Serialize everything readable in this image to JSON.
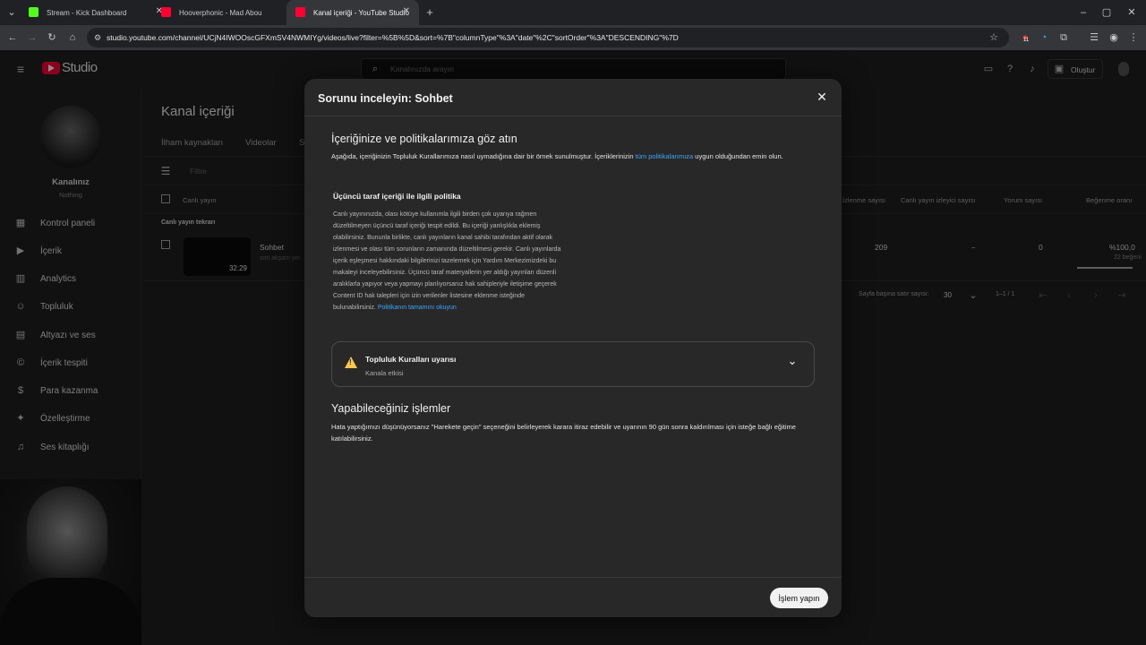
{
  "browser": {
    "tabs": [
      {
        "title": "Stream - Kick Dashboard",
        "color": "#53fc18"
      },
      {
        "title": "Hooverphonic - Mad Abou",
        "color": "#ff0033"
      },
      {
        "title": "Kanal içeriği - YouTube Studio",
        "color": "#ff0033"
      }
    ],
    "url": "studio.youtube.com/channel/UCjN4IWOOscGFXmSV4NWMIYg/videos/live?filter=%5B%5D&sort=%7B\"columnType\"%3A\"date\"%2C\"sortOrder\"%3A\"DESCENDING\"%7D",
    "ext_badge": "11"
  },
  "studio": {
    "logo": "Studio",
    "search_placeholder": "Kanalınızda arayın",
    "create_label": "Oluştur",
    "channel_name": "Kanalınız",
    "channel_sub": "Nothing",
    "nav": [
      {
        "label": "Kontrol paneli",
        "icon": "dashboard-icon",
        "glyph": "▦"
      },
      {
        "label": "İçerik",
        "icon": "content-icon",
        "glyph": "▶"
      },
      {
        "label": "Analytics",
        "icon": "analytics-icon",
        "glyph": "▥"
      },
      {
        "label": "Topluluk",
        "icon": "community-icon",
        "glyph": "☺"
      },
      {
        "label": "Altyazı ve ses",
        "icon": "subtitles-icon",
        "glyph": "▤"
      },
      {
        "label": "İçerik tespiti",
        "icon": "copyright-icon",
        "glyph": "©"
      },
      {
        "label": "Para kazanma",
        "icon": "monetization-icon",
        "glyph": "$"
      },
      {
        "label": "Özelleştirme",
        "icon": "customization-icon",
        "glyph": "✦"
      },
      {
        "label": "Ses kitaplığı",
        "icon": "audio-library-icon",
        "glyph": "♫"
      }
    ],
    "page_title": "Kanal içeriği",
    "tabs": [
      "İlham kaynakları",
      "Videolar",
      "S"
    ],
    "filter_placeholder": "Filtre",
    "table": {
      "col_live": "Canlı yayın",
      "col_views": "İzlenme sayısı",
      "col_concurrent": "Canlı yayın izleyici sayısı",
      "col_comments": "Yorum sayısı",
      "col_likes": "Beğenme oranı",
      "section": "Canlı yayın tekrarı",
      "row": {
        "title": "Sohbet",
        "subtitle": "son akşam yer",
        "duration": "32:29",
        "views": "209",
        "concurrent": "–",
        "comments": "0",
        "like_ratio": "%100,0",
        "likes": "22 beğeni"
      },
      "rows_per_page_label": "Sayfa başına satır sayısı:",
      "rows_per_page": "30",
      "range": "1–1 / 1"
    }
  },
  "modal": {
    "title": "Sorunu inceleyin: Sohbet",
    "section1_title": "İçeriğinize ve politikalarımıza göz atın",
    "section1_text_a": "Aşağıda, içeriğinizin Topluluk Kurallarımıza nasıl uymadığına dair bir örnek sunulmuştur. İçeriklerinizin ",
    "section1_link": "tüm politikalarımıza",
    "section1_text_b": " uygun olduğundan emin olun.",
    "policy_title": "Üçüncü taraf içeriği ile ilgili politika",
    "policy_body": "Canlı yayınınızda, olası kötüye kullanımla ilgili birden çok uyarıya rağmen düzeltilmeyen üçüncü taraf içeriği tespit edildi. Bu içeriği yanlışlıkla eklemiş olabilirsiniz. Bununla birlikte, canlı yayınların kanal sahibi tarafından aktif olarak izlenmesi ve olası tüm sorunların zamanında düzeltilmesi gerekir. Canlı yayınlarda içerik eşleşmesi hakkındaki bilgilerinizi tazelemek için Yardım Merkezimizdeki bu makaleyi inceleyebilirsiniz. Üçüncü taraf materyallerin yer aldığı yayınları düzenli aralıklarla yapıyor veya yapmayı planlıyorsanız hak sahipleriyle iletişime geçerek Content ID hak talepleri için izin verilenler listesine eklenme isteğinde bulunabilirsiniz. ",
    "policy_link": "Politikanın tamamını okuyun",
    "warning_title": "Topluluk Kuralları uyarısı",
    "warning_sub": "Kanala etkisi",
    "section2_title": "Yapabileceğiniz işlemler",
    "section2_text": "Hata yaptığımızı düşünüyorsanız \"Harekete geçin\" seçeneğini belirleyerek karara itiraz edebilir ve uyarının 90 gün sonra kaldırılması için isteğe bağlı eğitime katılabilirsiniz.",
    "action_button": "İşlem yapın"
  }
}
